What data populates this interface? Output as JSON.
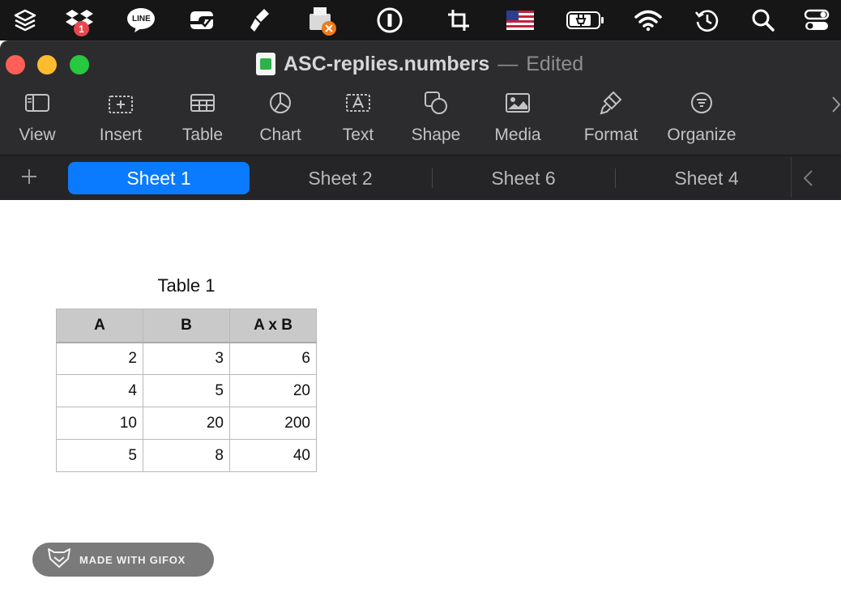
{
  "menubar": {
    "dropbox_badge": "1",
    "line_label": "LINE",
    "icons": [
      "shortcuts-icon",
      "dropbox-icon",
      "line-icon",
      "paste-icon",
      "cleaner-icon",
      "printer-icon",
      "onepassword-icon",
      "crop-icon",
      "us-flag-icon",
      "battery-icon",
      "wifi-icon",
      "time-machine-icon",
      "spotlight-icon",
      "control-center-icon"
    ]
  },
  "window": {
    "title": "ASC-replies.numbers",
    "title_separator": "—",
    "title_status": "Edited"
  },
  "toolbar": {
    "view": "View",
    "insert": "Insert",
    "table": "Table",
    "chart": "Chart",
    "text": "Text",
    "shape": "Shape",
    "media": "Media",
    "format": "Format",
    "organize": "Organize"
  },
  "sheets": {
    "tabs": [
      {
        "label": "Sheet 1",
        "active": true
      },
      {
        "label": "Sheet 2",
        "active": false
      },
      {
        "label": "Sheet 6",
        "active": false
      },
      {
        "label": "Sheet 4",
        "active": false
      }
    ]
  },
  "table": {
    "title": "Table 1",
    "headers": [
      "A",
      "B",
      "A x B"
    ],
    "rows": [
      [
        "2",
        "3",
        "6"
      ],
      [
        "4",
        "5",
        "20"
      ],
      [
        "10",
        "20",
        "200"
      ],
      [
        "5",
        "8",
        "40"
      ]
    ]
  },
  "watermark": {
    "text": "MADE WITH GIFOX"
  },
  "colors": {
    "accent": "#0a7aff",
    "toolbar_bg": "#2c2c2e",
    "header_cell": "#c9c9c9"
  }
}
